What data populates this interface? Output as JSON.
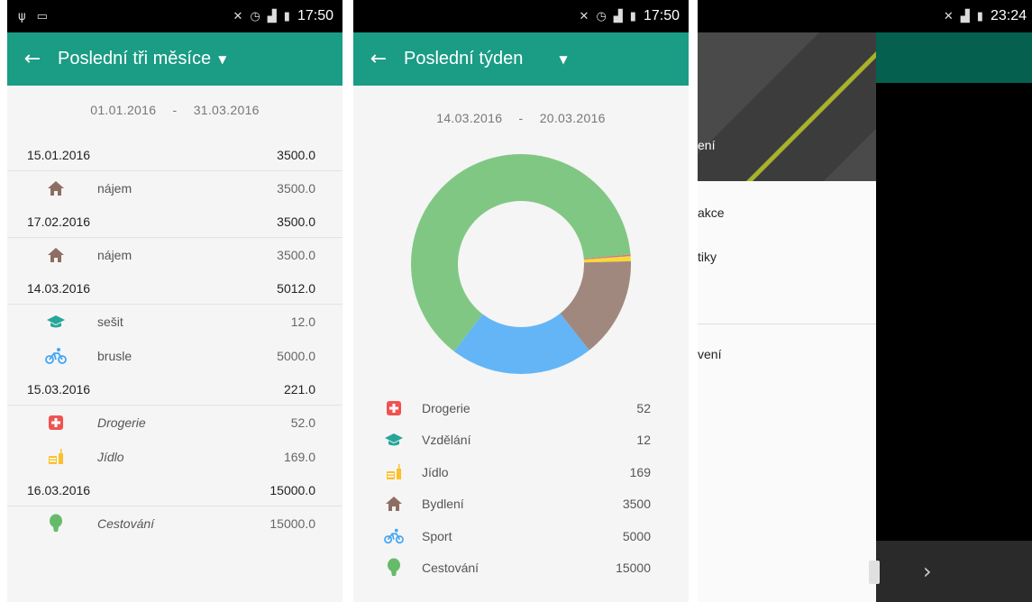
{
  "screen1": {
    "status_time": "17:50",
    "title": "Poslední tři měsíce",
    "date_from": "01.01.2016",
    "date_to": "31.03.2016",
    "date_sep": "-",
    "groups": [
      {
        "date": "15.01.2016",
        "total": "3500.0",
        "items": [
          {
            "icon": "home-icon",
            "name": "nájem",
            "value": "3500.0",
            "italic": false
          }
        ]
      },
      {
        "date": "17.02.2016",
        "total": "3500.0",
        "items": [
          {
            "icon": "home-icon",
            "name": "nájem",
            "value": "3500.0",
            "italic": false
          }
        ]
      },
      {
        "date": "14.03.2016",
        "total": "5012.0",
        "items": [
          {
            "icon": "graduation-cap-icon",
            "name": "sešit",
            "value": "12.0",
            "italic": false
          },
          {
            "icon": "bicycle-icon",
            "name": "brusle",
            "value": "5000.0",
            "italic": false
          }
        ]
      },
      {
        "date": "15.03.2016",
        "total": "221.0",
        "items": [
          {
            "icon": "first-aid-icon",
            "name": "Drogerie",
            "value": "52.0",
            "italic": true
          },
          {
            "icon": "food-icon",
            "name": "Jídlo",
            "value": "169.0",
            "italic": true
          }
        ]
      },
      {
        "date": "16.03.2016",
        "total": "15000.0",
        "items": [
          {
            "icon": "balloon-icon",
            "name": "Cestování",
            "value": "15000.0",
            "italic": true
          }
        ]
      }
    ]
  },
  "screen2": {
    "status_time": "17:50",
    "title": "Poslední týden",
    "date_from": "14.03.2016",
    "date_to": "20.03.2016",
    "date_sep": "-",
    "legend": [
      {
        "icon": "first-aid-icon",
        "name": "Drogerie",
        "value": "52"
      },
      {
        "icon": "graduation-cap-icon",
        "name": "Vzdělání",
        "value": "12"
      },
      {
        "icon": "food-icon",
        "name": "Jídlo",
        "value": "169"
      },
      {
        "icon": "home-icon",
        "name": "Bydlení",
        "value": "3500"
      },
      {
        "icon": "bicycle-icon",
        "name": "Sport",
        "value": "5000"
      },
      {
        "icon": "balloon-icon",
        "name": "Cestování",
        "value": "15000"
      }
    ]
  },
  "chart_data": {
    "type": "pie",
    "categories": [
      "Drogerie",
      "Vzdělání",
      "Jídlo",
      "Bydlení",
      "Sport",
      "Cestování"
    ],
    "values": [
      52,
      12,
      169,
      3500,
      5000,
      15000
    ],
    "colors": [
      "#e57373",
      "#4db6ac",
      "#fdd835",
      "#a1887f",
      "#64b5f6",
      "#81c784"
    ],
    "donut": true,
    "title": ""
  },
  "screen3": {
    "status_time": "23:24",
    "header_label": "ení",
    "items": [
      "akce",
      "tiky",
      "vení"
    ]
  },
  "colors": {
    "primary": "#1a9c85",
    "primary_dark": "#06604f",
    "icon_home": "#8d6e63",
    "icon_edu": "#26a69a",
    "icon_bike": "#42a5f5",
    "icon_aid": "#ef5350",
    "icon_food": "#fbc02d",
    "icon_balloon": "#66bb6a"
  }
}
